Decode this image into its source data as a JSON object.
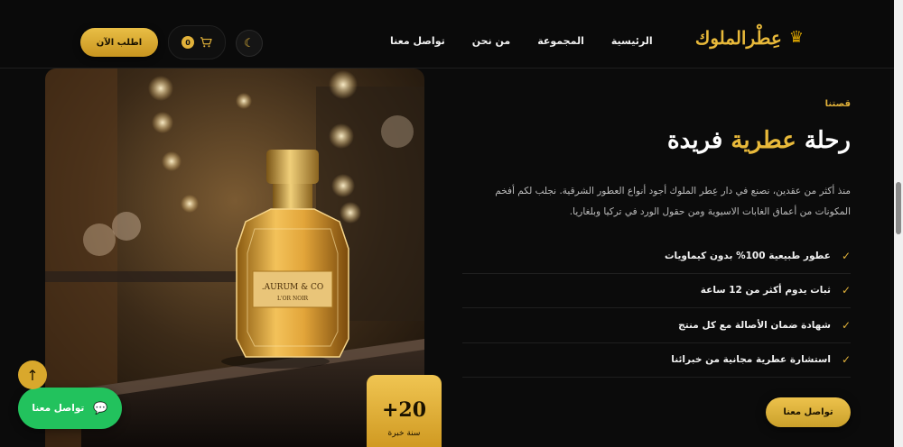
{
  "header": {
    "logo_text": "عِطْرالملوك",
    "logo_icon": "crown-icon",
    "nav": [
      {
        "label": "الرئيسية"
      },
      {
        "label": "المجموعة"
      },
      {
        "label": "من نحن"
      },
      {
        "label": "تواصل معنا"
      }
    ],
    "theme_icon": "moon-icon",
    "cart_count": "0",
    "order_button": "اطلب الآن"
  },
  "hero": {
    "bottle_label_line1": "AURUM & CO.",
    "bottle_label_line2": "L'OR NOIR",
    "years_number": "+20",
    "years_label": "سنة خبرة"
  },
  "story": {
    "eyebrow": "قصتنا",
    "title_part1": "رحلة ",
    "title_accent": "عطرية",
    "title_part2": " فريدة",
    "description": "منذ أكثر من عقدين، نصنع في دار عِطر الملوك أجود أنواع العطور الشرقية. نجلب لكم أفخم المكونات من أعماق الغابات الاسيوية ومن حقول الورد في تركيا وبلغاريا.",
    "features": [
      {
        "text": "عطور طبيعية 100% بدون كيماويات"
      },
      {
        "text": "ثبات يدوم أكثر من 12 ساعة"
      },
      {
        "text": "شهادة ضمان الأصالة مع كل منتج"
      },
      {
        "text": "استشارة عطرية مجانية من خبرائنا"
      }
    ],
    "check_symbol": "✓",
    "contact_button": "تواصل معنا"
  },
  "floating": {
    "scroll_top_symbol": "↑",
    "whatsapp_label": "تواصل معنا"
  },
  "colors": {
    "gold": "#e2b23a",
    "background": "#0b0b0b",
    "whatsapp_green": "#22c25d"
  }
}
